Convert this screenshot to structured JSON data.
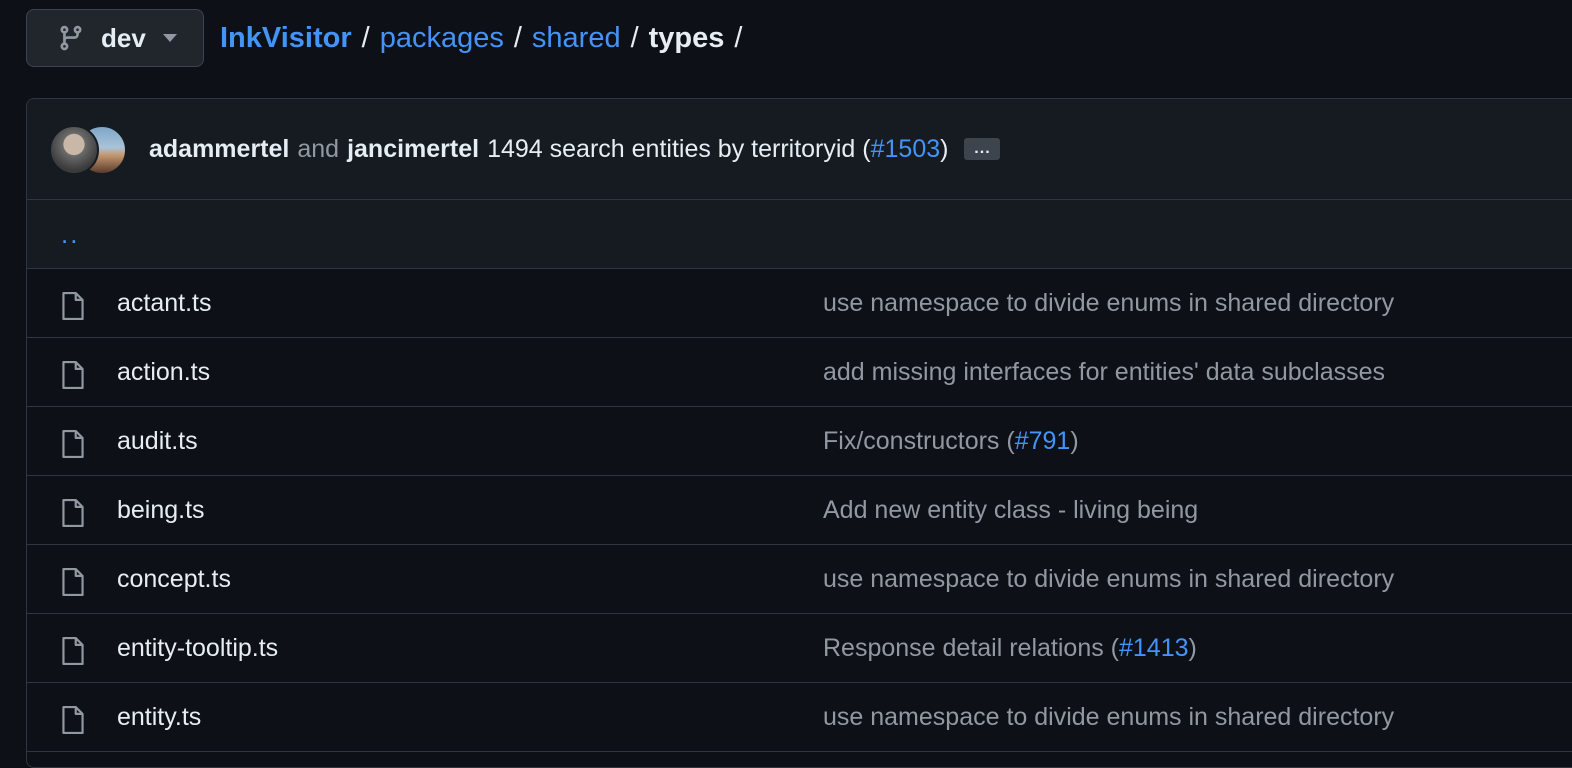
{
  "branch": {
    "name": "dev",
    "icon": "git-branch-icon"
  },
  "breadcrumb": {
    "repo": "InkVisitor",
    "parts": [
      "packages",
      "shared"
    ],
    "current": "types",
    "separator": "/"
  },
  "commit": {
    "author1": "adammertel",
    "and_text": "and",
    "author2": "jancimertel",
    "message": "1494 search entities by territoryid (",
    "pr": "#1503",
    "message_end": ")",
    "ellipsis": "..."
  },
  "parent_dir": "..",
  "files": [
    {
      "name": "actant.ts",
      "msg": "use namespace to divide enums in shared directory",
      "pr": "",
      "msg_end": ""
    },
    {
      "name": "action.ts",
      "msg": "add missing interfaces for entities' data subclasses",
      "pr": "",
      "msg_end": ""
    },
    {
      "name": "audit.ts",
      "msg": "Fix/constructors (",
      "pr": "#791",
      "msg_end": ")"
    },
    {
      "name": "being.ts",
      "msg": "Add new entity class - living being",
      "pr": "",
      "msg_end": ""
    },
    {
      "name": "concept.ts",
      "msg": "use namespace to divide enums in shared directory",
      "pr": "",
      "msg_end": ""
    },
    {
      "name": "entity-tooltip.ts",
      "msg": "Response detail relations (",
      "pr": "#1413",
      "msg_end": ")"
    },
    {
      "name": "entity.ts",
      "msg": "use namespace to divide enums in shared directory",
      "pr": "",
      "msg_end": ""
    }
  ],
  "colors": {
    "background": "#0d1117",
    "link": "#4493f8",
    "muted": "#9198a1",
    "border": "#30363d"
  }
}
